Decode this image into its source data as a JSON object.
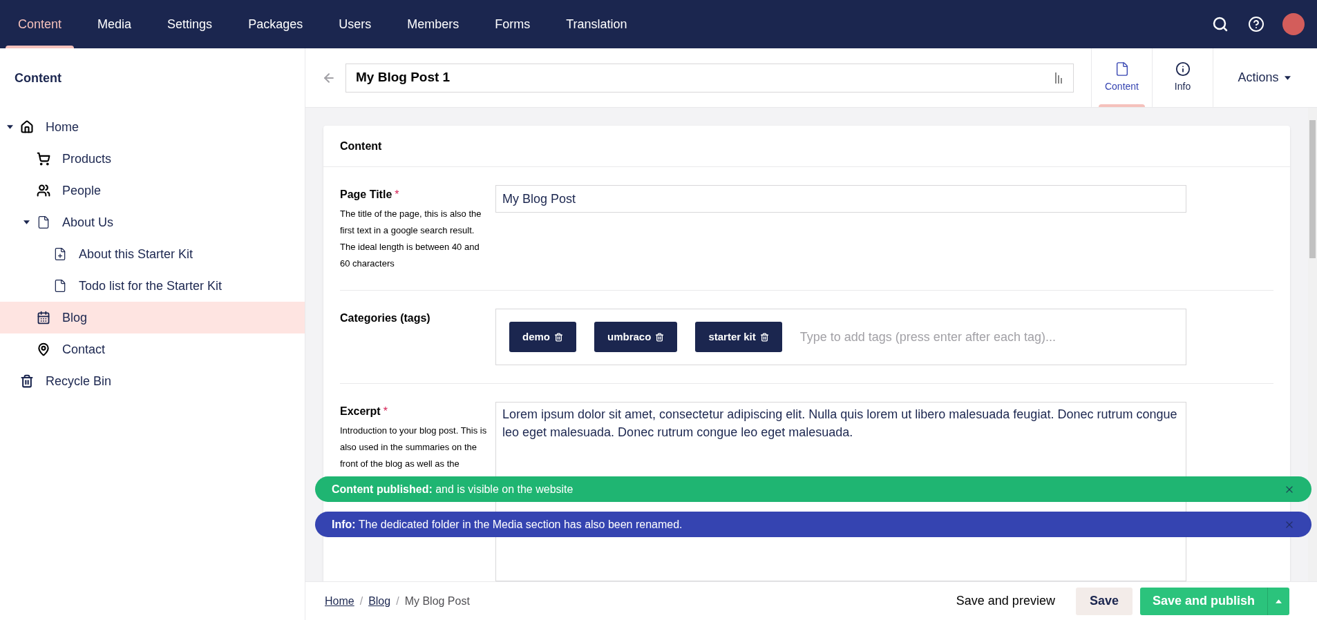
{
  "top_nav": {
    "sections": [
      {
        "label": "Content",
        "selected": true
      },
      {
        "label": "Media",
        "selected": false
      },
      {
        "label": "Settings",
        "selected": false
      },
      {
        "label": "Packages",
        "selected": false
      },
      {
        "label": "Users",
        "selected": false
      },
      {
        "label": "Members",
        "selected": false
      },
      {
        "label": "Forms",
        "selected": false
      },
      {
        "label": "Translation",
        "selected": false
      }
    ]
  },
  "sidebar": {
    "title": "Content",
    "tree": [
      {
        "label": "Home",
        "kind": "home",
        "expanded": true,
        "selected": false,
        "children": [
          {
            "label": "Products",
            "kind": "cart",
            "selected": false
          },
          {
            "label": "People",
            "kind": "people",
            "selected": false
          },
          {
            "label": "About Us",
            "kind": "doc",
            "expanded": true,
            "selected": false,
            "children": [
              {
                "label": "About this Starter Kit",
                "kind": "docplus",
                "selected": false
              },
              {
                "label": "Todo list for the Starter Kit",
                "kind": "doc",
                "selected": false
              }
            ]
          },
          {
            "label": "Blog",
            "kind": "calendar",
            "selected": true
          },
          {
            "label": "Contact",
            "kind": "pin",
            "selected": false
          }
        ]
      },
      {
        "label": "Recycle Bin",
        "kind": "trash",
        "selected": false
      }
    ]
  },
  "editor_header": {
    "name": "My Blog Post 1",
    "apps": [
      {
        "label": "Content",
        "kind": "doc",
        "selected": true
      },
      {
        "label": "Info",
        "kind": "info",
        "selected": false
      }
    ],
    "actions": "Actions"
  },
  "card": {
    "title": "Content",
    "properties": [
      {
        "kind": "text",
        "label": "Page Title",
        "required_mark": "*",
        "description": "The title of the page, this is also the first text in a google search result. The ideal length is between 40 and 60 characters",
        "value": "My Blog Post"
      },
      {
        "kind": "tags",
        "label": "Categories (tags)",
        "tags": [
          "demo",
          "umbraco",
          "starter kit"
        ],
        "placeholder": "Type to add tags (press enter after each tag)..."
      },
      {
        "kind": "textarea",
        "label": "Excerpt",
        "required_mark": "*",
        "description": "Introduction to your blog post. This is also used in the summaries on the front of the blog as well as the",
        "value": "Lorem ipsum dolor sit amet, consectetur adipiscing elit. Nulla quis lorem ut libero malesuada feugiat. Donec rutrum congue leo eget malesuada. Donec rutrum congue leo eget malesuada."
      }
    ]
  },
  "notifications": [
    {
      "kind": "success",
      "title": "Content published:",
      "message": "and is visible on the website"
    },
    {
      "kind": "info",
      "title": "Info:",
      "message": "The dedicated folder in the Media section has also been renamed."
    }
  ],
  "footer": {
    "breadcrumbs": [
      {
        "label": "Home",
        "link": true
      },
      {
        "separator": "/",
        "label": "Blog",
        "link": true
      },
      {
        "separator": "/",
        "label": "My Blog Post",
        "link": false
      }
    ],
    "buttons": [
      {
        "kind": "link",
        "label": "Save and preview"
      },
      {
        "kind": "secondary",
        "label": "Save"
      },
      {
        "kind": "primary",
        "label": "Save and publish"
      }
    ]
  }
}
